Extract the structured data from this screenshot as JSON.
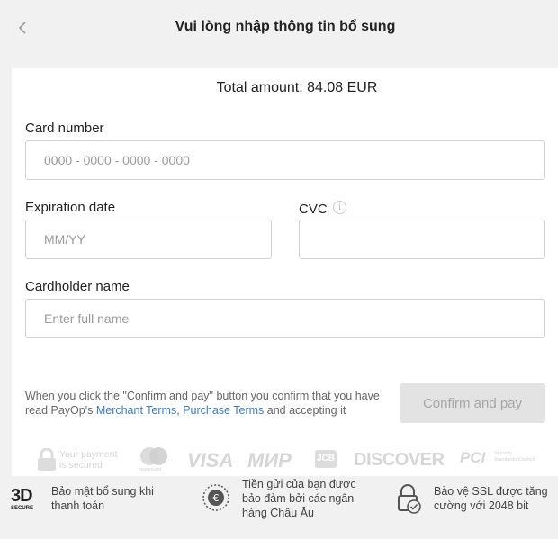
{
  "header": {
    "back_icon": "chevron-left-icon",
    "title": "Vui lòng nhập thông tin bổ sung"
  },
  "payment": {
    "total_label": "Total amount:",
    "total_value": "84.08 EUR",
    "card_number": {
      "label": "Card number",
      "placeholder": "0000 - 0000 - 0000 - 0000",
      "value": ""
    },
    "expiry": {
      "label": "Expiration date",
      "placeholder": "MM/YY",
      "value": ""
    },
    "cvc": {
      "label": "CVC",
      "placeholder": "",
      "value": "",
      "info_icon": "info-icon"
    },
    "cardholder": {
      "label": "Cardholder name",
      "placeholder": "Enter full name",
      "value": ""
    },
    "legal": {
      "text_before": "When you click the \"Confirm and pay\" button you confirm that you have read PayOp's ",
      "merchant_terms": "Merchant Terms",
      "comma": ",",
      "purchase_terms": "Purchase Terms",
      "text_after": " and accepting it"
    },
    "confirm_button": "Confirm and pay"
  },
  "logos": {
    "secured_text_1": "Your payment",
    "secured_text_2": "is secured",
    "mastercard_text": "mastercard",
    "visa": "VISA",
    "mir": "МИР",
    "jcb": "JCB",
    "discover": "DISCOVER",
    "pci": "PCI",
    "pci_sub_1": "Security",
    "pci_sub_2": "Standards Council"
  },
  "footer": {
    "items": [
      {
        "icon": "3d-secure-icon",
        "icon_big": "3D",
        "icon_small": "SECURE",
        "text": "Bảo mật bổ sung khi thanh toán"
      },
      {
        "icon": "euro-shield-icon",
        "text": "Tiền gửi của bạn được bảo đảm bởi các ngân hàng Châu Âu"
      },
      {
        "icon": "ssl-lock-icon",
        "text": "Bảo vệ SSL được tăng cường với 2048 bit"
      }
    ]
  },
  "colors": {
    "link": "#3f7bc0",
    "button_bg": "#e3e3e3",
    "page_bg": "#f1f1f1"
  }
}
